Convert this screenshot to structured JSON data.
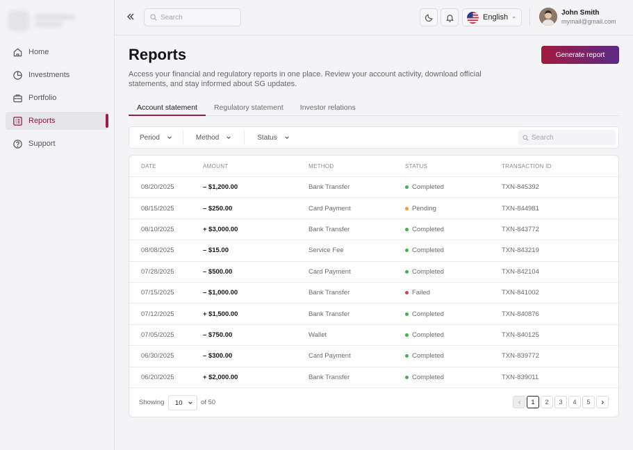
{
  "sidebar": {
    "items": [
      {
        "label": "Home",
        "icon": "home-icon"
      },
      {
        "label": "Investments",
        "icon": "pie-chart-icon"
      },
      {
        "label": "Portfolio",
        "icon": "briefcase-icon"
      },
      {
        "label": "Reports",
        "icon": "list-icon",
        "active": true
      },
      {
        "label": "Support",
        "icon": "help-icon"
      }
    ]
  },
  "topbar": {
    "search_placeholder": "Search",
    "language": "English",
    "user": {
      "name": "John Smith",
      "email": "mymail@gmail.com"
    }
  },
  "page": {
    "title": "Reports",
    "generate_label": "Generate report",
    "description": "Access your financial and regulatory reports in one place. Review your account activity, download official statements, and stay informed about SG updates."
  },
  "tabs": [
    {
      "label": "Account statement",
      "active": true
    },
    {
      "label": "Regulatory statement",
      "active": false
    },
    {
      "label": "Investor relations",
      "active": false
    }
  ],
  "filters": {
    "period": "Period",
    "method": "Method",
    "status": "Status",
    "search_placeholder": "Search"
  },
  "table": {
    "headers": {
      "date": "DATE",
      "amount": "AMOUNT",
      "method": "METHOD",
      "status": "STATUS",
      "txn": "TRANSACTION ID"
    },
    "rows": [
      {
        "date": "08/20/2025",
        "amount": "– $1,200.00",
        "method": "Bank Transfer",
        "status": "Completed",
        "txn": "TXN-845392"
      },
      {
        "date": "08/15/2025",
        "amount": "– $250.00",
        "method": "Card Payment",
        "status": "Pending",
        "txn": "TXN-844981"
      },
      {
        "date": "08/10/2025",
        "amount": "+ $3,000.00",
        "method": "Bank Transfer",
        "status": "Completed",
        "txn": "TXN-843772"
      },
      {
        "date": "08/08/2025",
        "amount": "– $15.00",
        "method": "Service Fee",
        "status": "Completed",
        "txn": "TXN-843219"
      },
      {
        "date": "07/28/2025",
        "amount": "– $500.00",
        "method": "Card Payment",
        "status": "Completed",
        "txn": "TXN-842104"
      },
      {
        "date": "07/15/2025",
        "amount": "– $1,000.00",
        "method": "Bank Transfer",
        "status": "Failed",
        "txn": "TXN-841002"
      },
      {
        "date": "07/12/2025",
        "amount": "+ $1,500.00",
        "method": "Bank Transfer",
        "status": "Completed",
        "txn": "TXN-840876"
      },
      {
        "date": "07/05/2025",
        "amount": "– $750.00",
        "method": "Wallet",
        "status": "Completed",
        "txn": "TXN-840125"
      },
      {
        "date": "06/30/2025",
        "amount": "– $300.00",
        "method": "Card Payment",
        "status": "Completed",
        "txn": "TXN-839772"
      },
      {
        "date": "06/20/2025",
        "amount": "+ $2,000.00",
        "method": "Bank Transfer",
        "status": "Completed",
        "txn": "TXN-839011"
      }
    ]
  },
  "status_colors": {
    "Completed": "#3bb54a",
    "Pending": "#f59a23",
    "Failed": "#e23b4a"
  },
  "pagination": {
    "showing_label": "Showing",
    "per_page": "10",
    "of_total": "of 50",
    "pages": [
      "1",
      "2",
      "3",
      "4",
      "5"
    ],
    "current": "1"
  },
  "colors": {
    "accent": "#9c1c46",
    "gradient_start": "#a21a3d",
    "gradient_end": "#5b2a86"
  }
}
